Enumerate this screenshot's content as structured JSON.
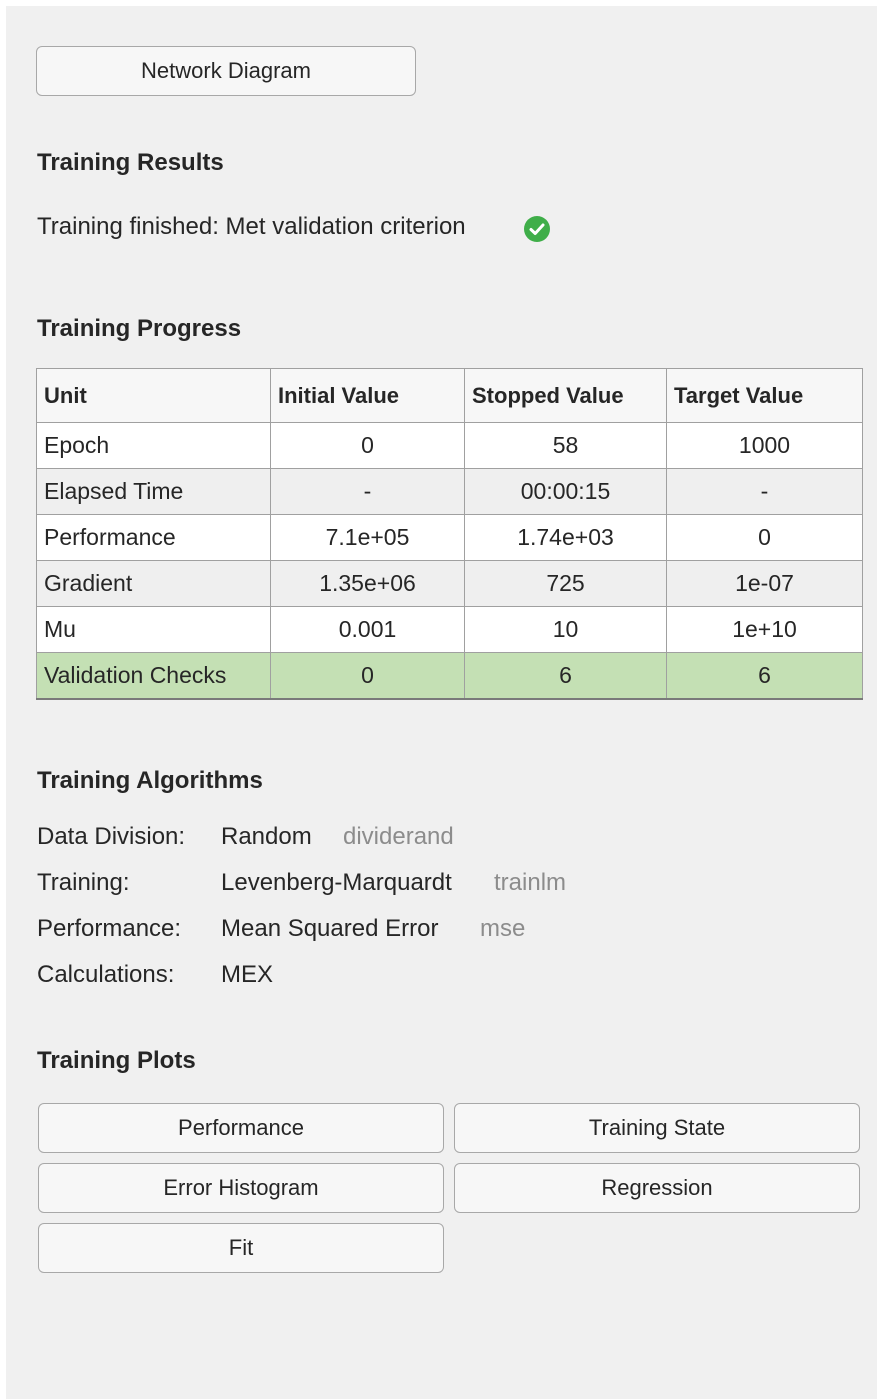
{
  "toolbar": {
    "network_diagram_label": "Network Diagram"
  },
  "results": {
    "heading": "Training Results",
    "status_text": "Training finished: Met validation criterion",
    "status_icon": "check-circle-icon",
    "status_color": "#3fae49"
  },
  "progress": {
    "heading": "Training Progress",
    "columns": [
      "Unit",
      "Initial Value",
      "Stopped Value",
      "Target Value"
    ],
    "rows": [
      {
        "unit": "Epoch",
        "initial": "0",
        "stopped": "58",
        "target": "1000"
      },
      {
        "unit": "Elapsed Time",
        "initial": "-",
        "stopped": "00:00:15",
        "target": "-"
      },
      {
        "unit": "Performance",
        "initial": "7.1e+05",
        "stopped": "1.74e+03",
        "target": "0"
      },
      {
        "unit": "Gradient",
        "initial": "1.35e+06",
        "stopped": "725",
        "target": "1e-07"
      },
      {
        "unit": "Mu",
        "initial": "0.001",
        "stopped": "10",
        "target": "1e+10"
      },
      {
        "unit": "Validation Checks",
        "initial": "0",
        "stopped": "6",
        "target": "6"
      }
    ],
    "highlight_color": "#c4e0b4"
  },
  "algorithms": {
    "heading": "Training Algorithms",
    "items": [
      {
        "label": "Data Division:",
        "value": "Random",
        "code": "dividerand"
      },
      {
        "label": "Training:",
        "value": "Levenberg-Marquardt",
        "code": "trainlm"
      },
      {
        "label": "Performance:",
        "value": "Mean Squared Error",
        "code": "mse"
      },
      {
        "label": "Calculations:",
        "value": "MEX",
        "code": ""
      }
    ]
  },
  "plots": {
    "heading": "Training Plots",
    "buttons": [
      "Performance",
      "Training State",
      "Error Histogram",
      "Regression",
      "Fit"
    ]
  }
}
